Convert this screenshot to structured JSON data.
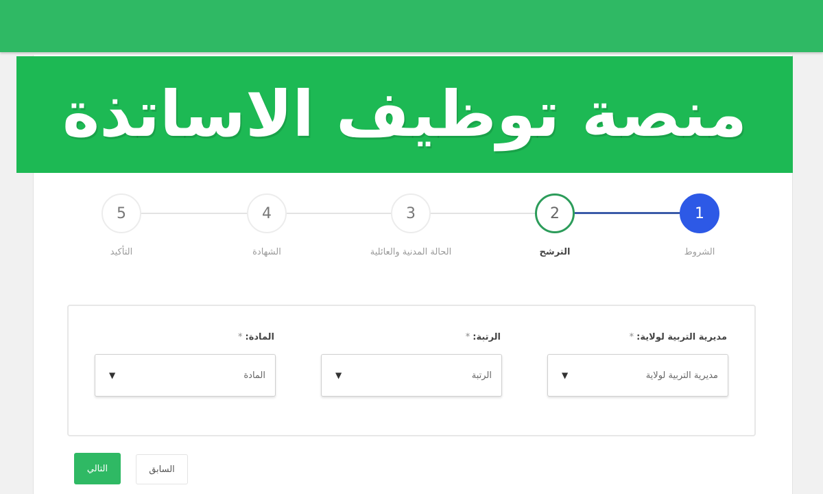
{
  "banner": {
    "title": "منصة توظيف الاساتذة"
  },
  "steps": [
    {
      "number": "1",
      "label": "الشروط",
      "state": "done"
    },
    {
      "number": "2",
      "label": "الترشح",
      "state": "current"
    },
    {
      "number": "3",
      "label": "الحالة المدنية والعائلية",
      "state": "pending"
    },
    {
      "number": "4",
      "label": "الشهادة",
      "state": "pending"
    },
    {
      "number": "5",
      "label": "التأكيد",
      "state": "pending"
    }
  ],
  "form": {
    "fields": [
      {
        "label": "مديرية التربية لولاية:",
        "required_mark": "*",
        "value": "مديرية التربية لولاية"
      },
      {
        "label": "الرتبة:",
        "required_mark": "*",
        "value": "الرتبة"
      },
      {
        "label": "المادة:",
        "required_mark": "*",
        "value": "المادة"
      }
    ]
  },
  "buttons": {
    "next_label": "التالي",
    "prev_label": "السابق"
  },
  "colors": {
    "brand_green": "#1db954",
    "step_done_blue": "#2d59e6",
    "step_current_green": "#2c9c5a"
  },
  "icons": {
    "dropdown": "caret-down-icon"
  }
}
